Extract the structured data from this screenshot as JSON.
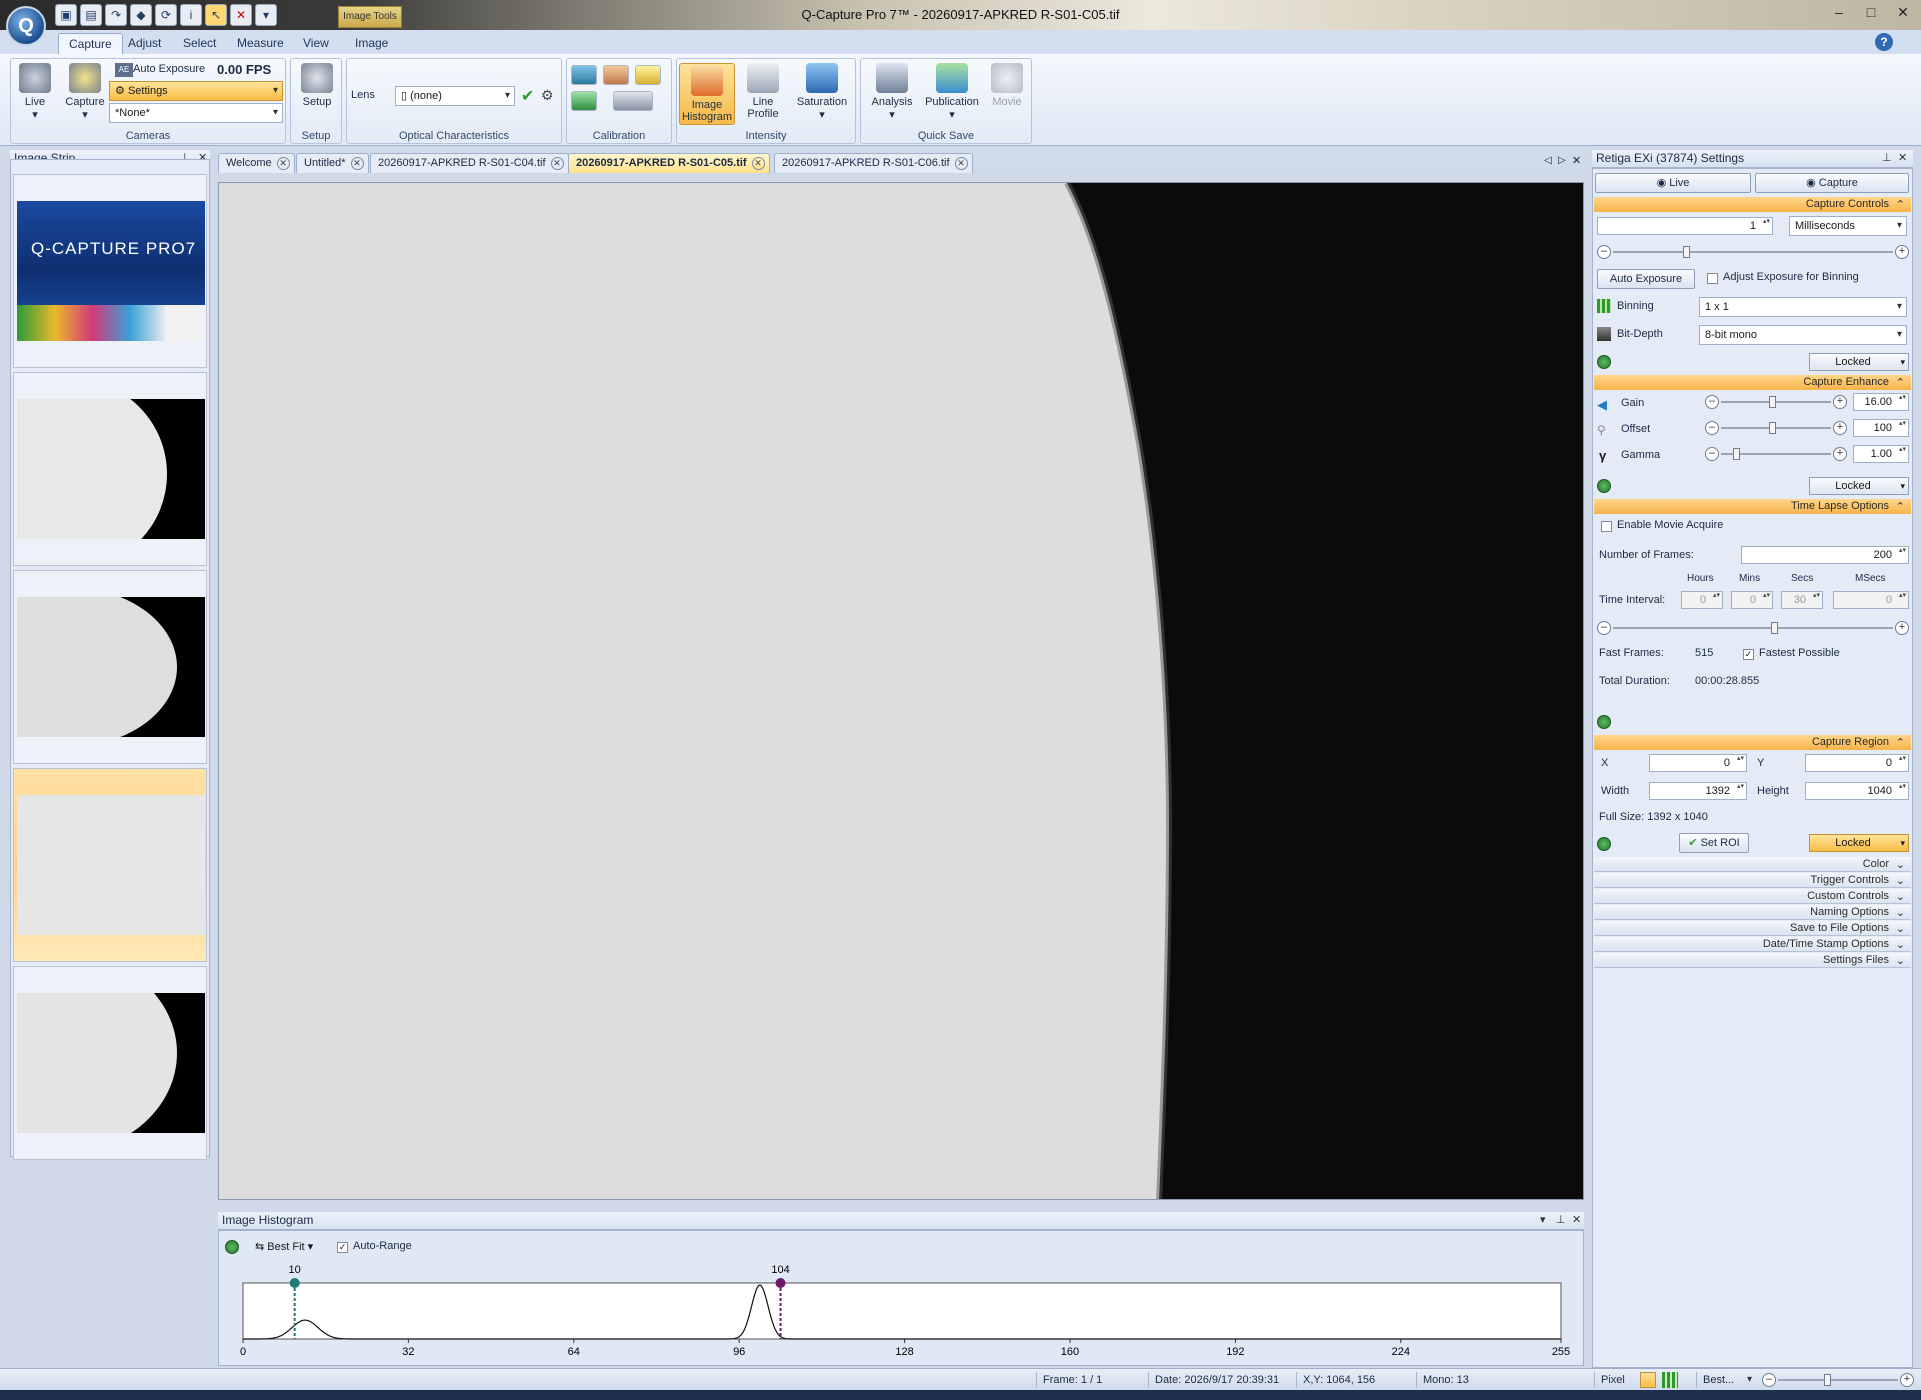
{
  "window": {
    "title": "Q-Capture Pro 7™ - 20260917-APKRED R-S01-C05.tif",
    "context_tab": "Image Tools",
    "controls": [
      "–",
      "□",
      "✕"
    ]
  },
  "ribbon_tabs": [
    "Capture",
    "Adjust",
    "Select",
    "Measure",
    "View",
    "Image"
  ],
  "cameras_group": {
    "label": "Cameras",
    "live": "Live",
    "capture": "Capture",
    "auto_exposure": "Auto Exposure",
    "fps": "0.00 FPS",
    "settings": "Settings",
    "preset": "*None*"
  },
  "setup_group": {
    "label": "Setup",
    "button": "Setup"
  },
  "optical_group": {
    "label": "Optical Characteristics",
    "lens_label": "Lens",
    "lens_value": "(none)"
  },
  "calibration_group": {
    "label": "Calibration"
  },
  "intensity_group": {
    "label": "Intensity",
    "image_histogram": "Image Histogram",
    "line_profile": "Line Profile",
    "saturation": "Saturation"
  },
  "quicksave_group": {
    "label": "Quick Save",
    "analysis": "Analysis",
    "publication": "Publication",
    "movie": "Movie"
  },
  "image_strip": {
    "title": "Image Strip",
    "splash_brand": "Q-CAPTURE PRO7"
  },
  "doc_tabs": [
    {
      "label": "Welcome"
    },
    {
      "label": "Untitled*"
    },
    {
      "label": "20260917-APKRED R-S01-C04.tif"
    },
    {
      "label": "20260917-APKRED R-S01-C05.tif",
      "active": true
    },
    {
      "label": "20260917-APKRED R-S01-C06.tif"
    }
  ],
  "histogram": {
    "title": "Image Histogram",
    "best_fit": "Best Fit",
    "auto_range": "Auto-Range",
    "low_marker": "10",
    "high_marker": "104",
    "low_value": 10,
    "high_value": 104,
    "axis_min": 0,
    "axis_max": 255,
    "ticks": [
      "0",
      "32",
      "64",
      "96",
      "128",
      "160",
      "192",
      "224",
      "255"
    ],
    "tick_values": [
      0,
      32,
      64,
      96,
      128,
      160,
      192,
      224,
      255
    ],
    "peaks": [
      {
        "center": 12,
        "height": 0.35,
        "width": 2.5
      },
      {
        "center": 100,
        "height": 1.0,
        "width": 1.6
      }
    ],
    "colors": {
      "low": "#1f7a78",
      "high": "#6b1a6e"
    }
  },
  "settings": {
    "title": "Retiga EXi (37874) Settings",
    "live_btn": "Live",
    "capture_btn": "Capture",
    "capture_controls": {
      "header": "Capture Controls",
      "exposure": "1",
      "unit": "Milliseconds",
      "auto_exposure": "Auto Exposure",
      "adjust_binning": "Adjust Exposure for Binning",
      "binning_label": "Binning",
      "binning": "1 x 1",
      "bitdepth_label": "Bit-Depth",
      "bitdepth": "8-bit mono",
      "locked": "Locked"
    },
    "capture_enhance": {
      "header": "Capture Enhance",
      "gain_label": "Gain",
      "gain": "16.00",
      "offset_label": "Offset",
      "offset": "100",
      "gamma_label": "Gamma",
      "gamma": "1.00",
      "locked": "Locked"
    },
    "time_lapse": {
      "header": "Time Lapse Options",
      "enable_movie": "Enable Movie Acquire",
      "frames_label": "Number of Frames:",
      "frames": "200",
      "hours_label": "Hours",
      "mins_label": "Mins",
      "secs_label": "Secs",
      "msecs_label": "MSecs",
      "interval_label": "Time Interval:",
      "hours": "0",
      "mins": "0",
      "secs": "30",
      "msecs": "0",
      "fast_frames_label": "Fast Frames:",
      "fast_frames": "515",
      "fastest": "Fastest Possible",
      "total_label": "Total Duration:",
      "total": "00:00:28.855"
    },
    "capture_region": {
      "header": "Capture Region",
      "x_label": "X",
      "x": "0",
      "y_label": "Y",
      "y": "0",
      "w_label": "Width",
      "w": "1392",
      "h_label": "Height",
      "h": "1040",
      "full_size": "Full Size: 1392 x 1040",
      "set_roi": "Set ROI",
      "locked": "Locked"
    },
    "collapsed": [
      "Color",
      "Trigger Controls",
      "Custom Controls",
      "Naming Options",
      "Save to File Options",
      "Date/Time Stamp Options",
      "Settings Files"
    ]
  },
  "status": {
    "frame": "Frame: 1 / 1",
    "date": "Date: 2026/9/17 20:39:31",
    "xy": "X,Y: 1064,  156",
    "mono": "Mono:   13",
    "pixel": "Pixel",
    "zoom": "Best..."
  }
}
